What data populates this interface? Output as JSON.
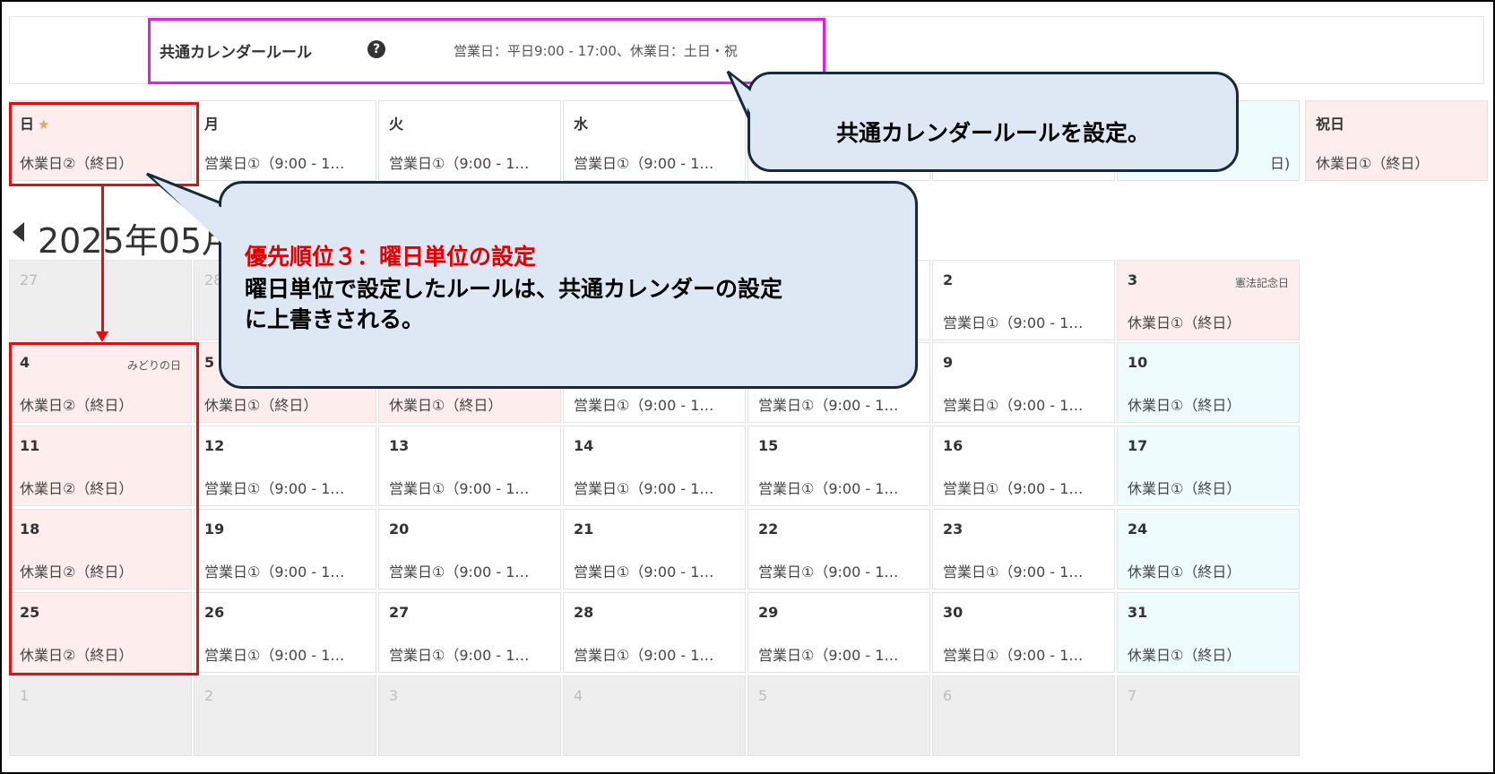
{
  "rule": {
    "title": "共通カレンダールール",
    "help_icon": "question-circle-icon",
    "text": "営業日：平日9:00 - 17:00、休業日：土日・祝"
  },
  "weekday_header": [
    {
      "day": "日",
      "status": "休業日②（終日）"
    },
    {
      "day": "月",
      "status": "営業日①（9:00 - 1…"
    },
    {
      "day": "火",
      "status": "営業日①（9:00 - 1…"
    },
    {
      "day": "水",
      "status": "営業日①（9:00 - 1…"
    },
    {
      "day": "",
      "status": ""
    },
    {
      "day": "",
      "status": ""
    },
    {
      "day": "",
      "status": "日)"
    },
    {
      "day": "祝日",
      "status": "休業日①（終日）"
    }
  ],
  "month_title": "2025年05月",
  "calendar": {
    "rows": [
      [
        {
          "d": "27",
          "s": "",
          "h": ""
        },
        {
          "d": "28",
          "s": "",
          "h": ""
        },
        {
          "d": "",
          "s": "",
          "h": ""
        },
        {
          "d": "",
          "s": "",
          "h": ""
        },
        {
          "d": "",
          "s": "",
          "h": ""
        },
        {
          "d": "2",
          "s": "営業日①（9:00 - 1…",
          "h": ""
        },
        {
          "d": "3",
          "s": "休業日①（終日）",
          "h": "憲法記念日"
        }
      ],
      [
        {
          "d": "4",
          "s": "休業日②（終日）",
          "h": "みどりの日"
        },
        {
          "d": "5",
          "s": "休業日①（終日）",
          "h": ""
        },
        {
          "d": "",
          "s": "休業日①（終日）",
          "h": ""
        },
        {
          "d": "",
          "s": "営業日①（9:00 - 1…",
          "h": ""
        },
        {
          "d": "",
          "s": "営業日①（9:00 - 1…",
          "h": ""
        },
        {
          "d": "9",
          "s": "営業日①（9:00 - 1…",
          "h": ""
        },
        {
          "d": "10",
          "s": "休業日①（終日）",
          "h": ""
        }
      ],
      [
        {
          "d": "11",
          "s": "休業日②（終日）",
          "h": ""
        },
        {
          "d": "12",
          "s": "営業日①（9:00 - 1…",
          "h": ""
        },
        {
          "d": "13",
          "s": "営業日①（9:00 - 1…",
          "h": ""
        },
        {
          "d": "14",
          "s": "営業日①（9:00 - 1…",
          "h": ""
        },
        {
          "d": "15",
          "s": "営業日①（9:00 - 1…",
          "h": ""
        },
        {
          "d": "16",
          "s": "営業日①（9:00 - 1…",
          "h": ""
        },
        {
          "d": "17",
          "s": "休業日①（終日）",
          "h": ""
        }
      ],
      [
        {
          "d": "18",
          "s": "休業日②（終日）",
          "h": ""
        },
        {
          "d": "19",
          "s": "営業日①（9:00 - 1…",
          "h": ""
        },
        {
          "d": "20",
          "s": "営業日①（9:00 - 1…",
          "h": ""
        },
        {
          "d": "21",
          "s": "営業日①（9:00 - 1…",
          "h": ""
        },
        {
          "d": "22",
          "s": "営業日①（9:00 - 1…",
          "h": ""
        },
        {
          "d": "23",
          "s": "営業日①（9:00 - 1…",
          "h": ""
        },
        {
          "d": "24",
          "s": "休業日①（終日）",
          "h": ""
        }
      ],
      [
        {
          "d": "25",
          "s": "休業日②（終日）",
          "h": ""
        },
        {
          "d": "26",
          "s": "営業日①（9:00 - 1…",
          "h": ""
        },
        {
          "d": "27",
          "s": "営業日①（9:00 - 1…",
          "h": ""
        },
        {
          "d": "28",
          "s": "営業日①（9:00 - 1…",
          "h": ""
        },
        {
          "d": "29",
          "s": "営業日①（9:00 - 1…",
          "h": ""
        },
        {
          "d": "30",
          "s": "営業日①（9:00 - 1…",
          "h": ""
        },
        {
          "d": "31",
          "s": "休業日①（終日）",
          "h": ""
        }
      ],
      [
        {
          "d": "1",
          "s": "",
          "h": ""
        },
        {
          "d": "2",
          "s": "",
          "h": ""
        },
        {
          "d": "3",
          "s": "",
          "h": ""
        },
        {
          "d": "4",
          "s": "",
          "h": ""
        },
        {
          "d": "5",
          "s": "",
          "h": ""
        },
        {
          "d": "6",
          "s": "",
          "h": ""
        },
        {
          "d": "7",
          "s": "",
          "h": ""
        }
      ]
    ]
  },
  "callout1": {
    "text": "共通カレンダールールを設定。"
  },
  "callout2": {
    "title": "優先順位３：曜日単位の設定",
    "line1": "曜日単位で設定したルールは、共通カレンダーの設定",
    "line2": "に上書きされる。"
  },
  "colors": {
    "holiday_bg": "#fdeeed",
    "weekend_bg": "#effcfd",
    "outside_bg": "#eeeeee",
    "highlight_red": "#e01010",
    "highlight_magenta": "#e020e0",
    "callout_bg": "#dde8f4"
  }
}
